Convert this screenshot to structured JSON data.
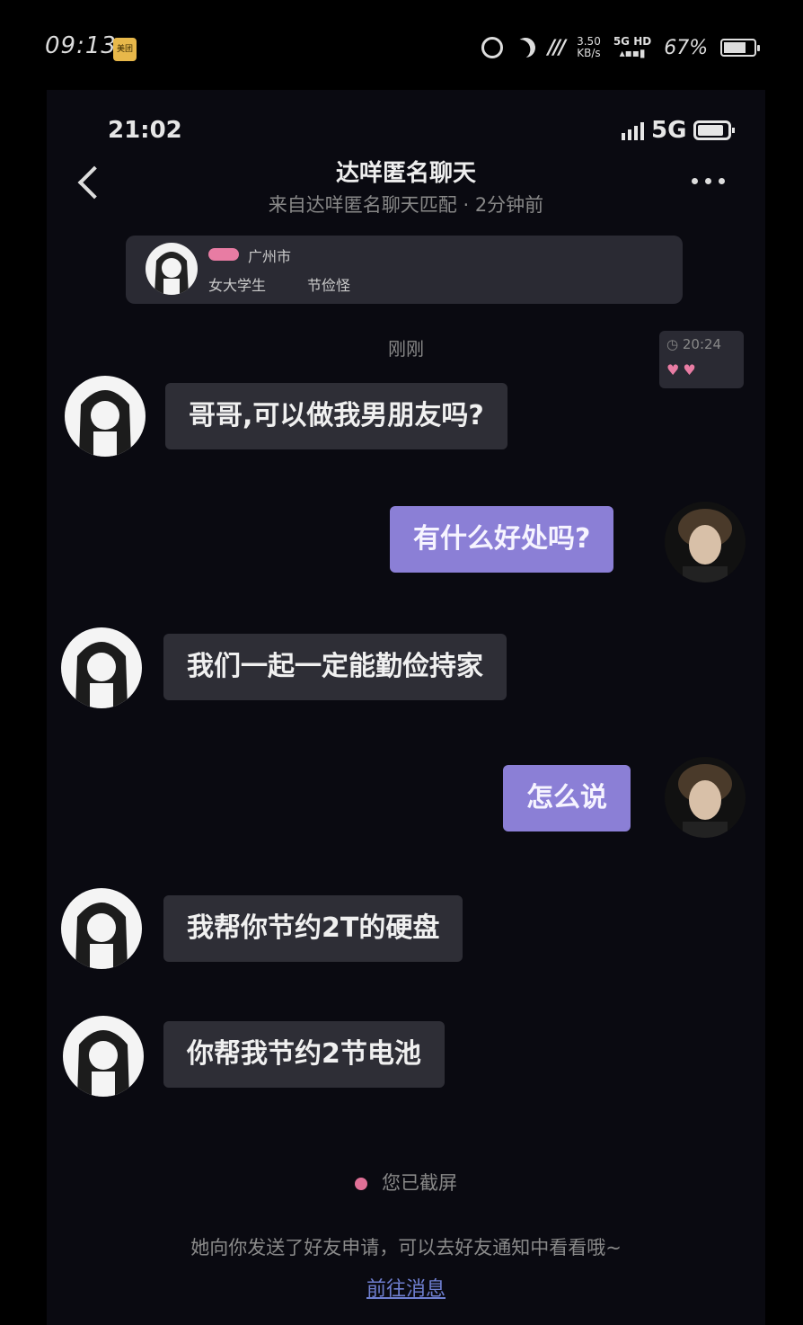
{
  "outer_status": {
    "time": "09:13",
    "app_badge": "美团",
    "speed_value": "3.50",
    "speed_unit": "KB/s",
    "network_top": "5G HD",
    "battery": "67%"
  },
  "inner_status": {
    "time": "21:02",
    "network": "5G"
  },
  "header": {
    "title": "达咩匿名聊天",
    "subtitle": "来自达咩匿名聊天匹配 · 2分钟前"
  },
  "profile": {
    "city": "广州市",
    "role": "女大学生",
    "trait": "节俭怪"
  },
  "timestamp": "刚刚",
  "mini_card": {
    "time": "20:24",
    "hearts": "♥♥"
  },
  "messages": [
    {
      "from": "her",
      "text": "哥哥,可以做我男朋友吗?"
    },
    {
      "from": "me",
      "text": "有什么好处吗?"
    },
    {
      "from": "her",
      "text": "我们一起一定能勤俭持家"
    },
    {
      "from": "me",
      "text": "怎么说"
    },
    {
      "from": "her",
      "text": "我帮你节约2T的硬盘"
    },
    {
      "from": "her",
      "text": "你帮我节约2节电池"
    }
  ],
  "footer": {
    "screenshot_notice": "您已截屏",
    "friend_request": "她向你发送了好友申请，可以去好友通知中看看哦~",
    "go_to_messages": "前往消息"
  },
  "colors": {
    "bubble_incoming": "#2e2e36",
    "bubble_outgoing": "#8b7fd6",
    "link": "#6f7fd0",
    "accent_pink": "#e87ca3"
  }
}
